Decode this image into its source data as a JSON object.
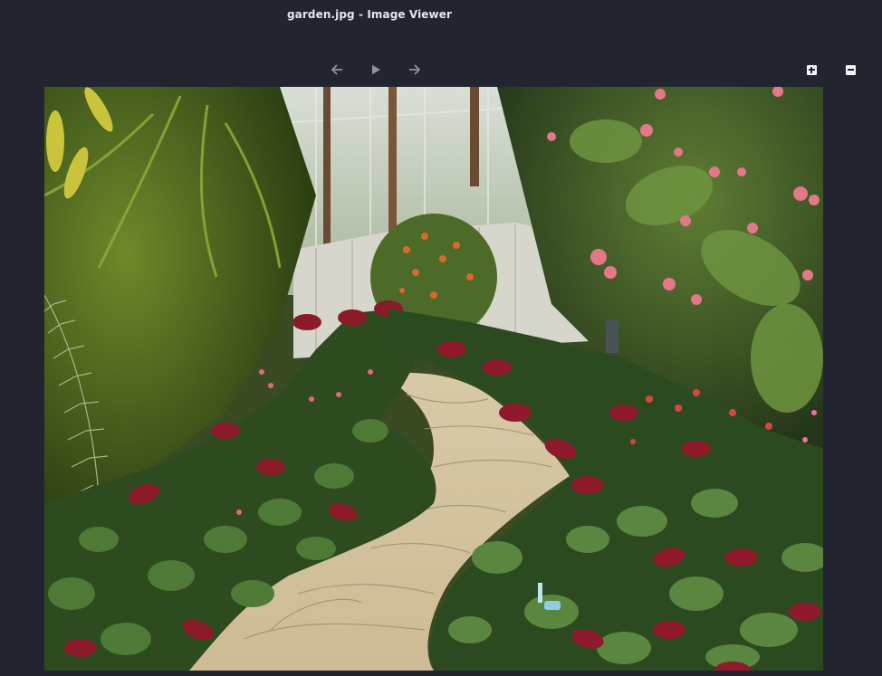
{
  "window": {
    "title": "garden.jpg - Image Viewer"
  },
  "toolbar": {
    "prev": {
      "icon": "arrow-left-icon"
    },
    "play": {
      "icon": "play-icon"
    },
    "next": {
      "icon": "arrow-right-icon"
    },
    "zoom_in": {
      "icon": "zoom-in-icon"
    },
    "zoom_out": {
      "icon": "zoom-out-icon"
    }
  },
  "image": {
    "description_alt": "garden.jpg"
  },
  "colors": {
    "background": "#222530",
    "title_text": "#e4e6ec",
    "nav_icon": "#8e939e",
    "zoom_icon": "#f2f3f6"
  }
}
